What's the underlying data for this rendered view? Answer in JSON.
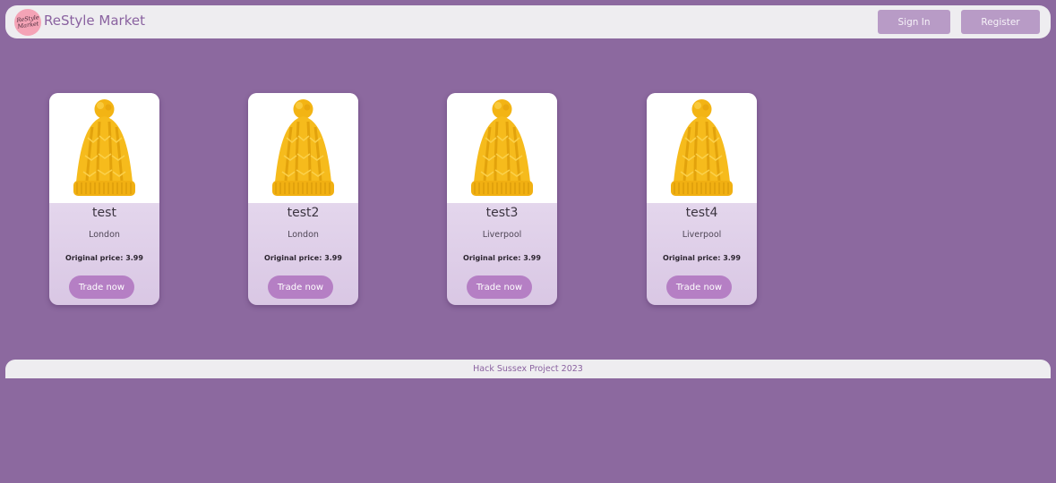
{
  "header": {
    "logo_text": "ReStyle Market",
    "brand": "ReStyle Market",
    "sign_in_label": "Sign In",
    "register_label": "Register"
  },
  "listings": [
    {
      "title": "test",
      "city": "London",
      "price_label": "Original price:",
      "price": "3.99",
      "button": "Trade now",
      "image_icon": "yellow-beanie-hat"
    },
    {
      "title": "test2",
      "city": "London",
      "price_label": "Original price:",
      "price": "3.99",
      "button": "Trade now",
      "image_icon": "yellow-beanie-hat"
    },
    {
      "title": "test3",
      "city": "Liverpool",
      "price_label": "Original price:",
      "price": "3.99",
      "button": "Trade now",
      "image_icon": "yellow-beanie-hat"
    },
    {
      "title": "test4",
      "city": "Liverpool",
      "price_label": "Original price:",
      "price": "3.99",
      "button": "Trade now",
      "image_icon": "yellow-beanie-hat"
    }
  ],
  "footer": {
    "text": "Hack Sussex Project 2023"
  },
  "colors": {
    "background": "#8c699f",
    "bar": "#eeedf0",
    "accent_button": "#b57fc4",
    "nav_button": "#b89bc6",
    "brand_text": "#8a62a0",
    "hat_yellow": "#f6bb1c"
  }
}
